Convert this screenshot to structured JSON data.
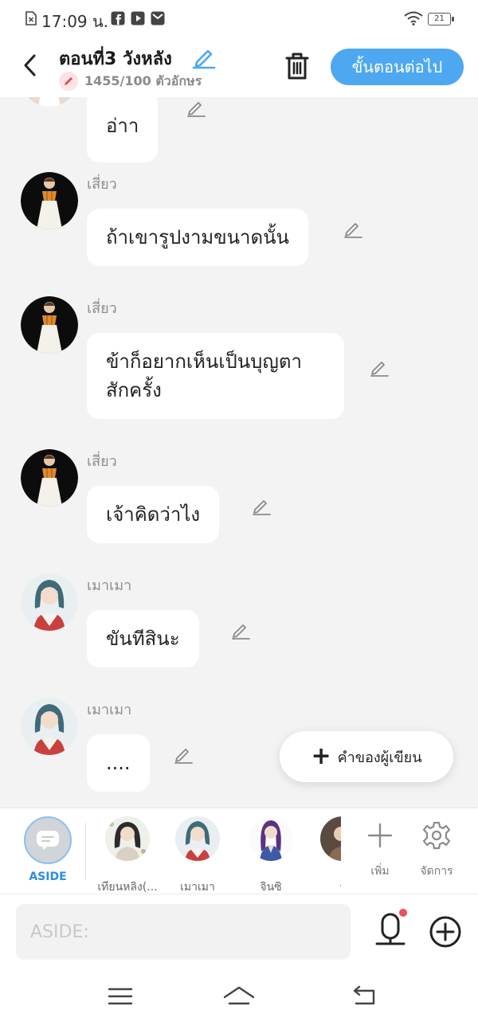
{
  "status_bar": {
    "time": "17:09 น.",
    "battery": "21"
  },
  "header": {
    "title": "ตอนที่3 วังหลัง",
    "char_count": "1455/100 ตัวอักษร",
    "next_button": "ขั้นตอนต่อไป",
    "accent_color": "#4da8f1"
  },
  "messages": [
    {
      "speaker": "",
      "text": "อ่าา"
    },
    {
      "speaker": "เสี่ยว",
      "text": "ถ้าเขารูปงามขนาดนั้น"
    },
    {
      "speaker": "เสี่ยว",
      "text": "ข้าก็อยากเห็นเป็นบุญตา สักครั้ง"
    },
    {
      "speaker": "เสี่ยว",
      "text": "เจ้าคิดว่าไง"
    },
    {
      "speaker": "เมาเมา",
      "text": "ขันทีสินะ"
    },
    {
      "speaker": "เมาเมา",
      "text": "...."
    }
  ],
  "fab": {
    "label": "คำของผู้เขียน"
  },
  "character_bar": {
    "aside_label": "ASIDE",
    "characters": [
      {
        "name": "เทียนหลิง(..."
      },
      {
        "name": "เมาเมา"
      },
      {
        "name": "จินซิ"
      },
      {
        "name": "ร"
      }
    ],
    "add_label": "เพิ่ม",
    "manage_label": "จัดการ"
  },
  "input": {
    "placeholder": "ASIDE:"
  }
}
